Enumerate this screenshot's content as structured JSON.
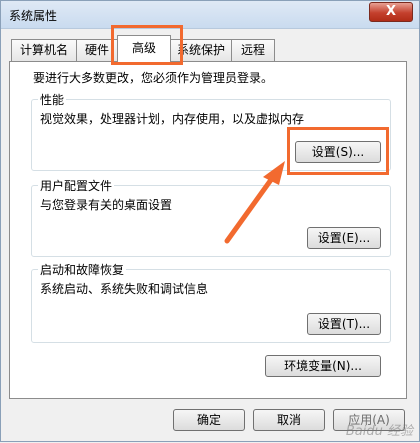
{
  "window": {
    "title": "系统属性",
    "close_label": "X"
  },
  "tabs": [
    {
      "label": "计算机名"
    },
    {
      "label": "硬件"
    },
    {
      "label": "高级"
    },
    {
      "label": "系统保护"
    },
    {
      "label": "远程"
    }
  ],
  "active_tab": "高级",
  "notice": "要进行大多数更改，您必须作为管理员登录。",
  "groups": {
    "performance": {
      "title": "性能",
      "desc": "视觉效果，处理器计划，内存使用，以及虚拟内存",
      "button": "设置(S)..."
    },
    "user_profiles": {
      "title": "用户配置文件",
      "desc": "与您登录有关的桌面设置",
      "button": "设置(E)..."
    },
    "startup": {
      "title": "启动和故障恢复",
      "desc": "系统启动、系统失败和调试信息",
      "button": "设置(T)..."
    }
  },
  "env_button": "环境变量(N)...",
  "footer": {
    "ok": "确定",
    "cancel": "取消",
    "apply": "应用(A)"
  },
  "annotation_color": "#f26a2f",
  "watermark": "Baidu 经验"
}
